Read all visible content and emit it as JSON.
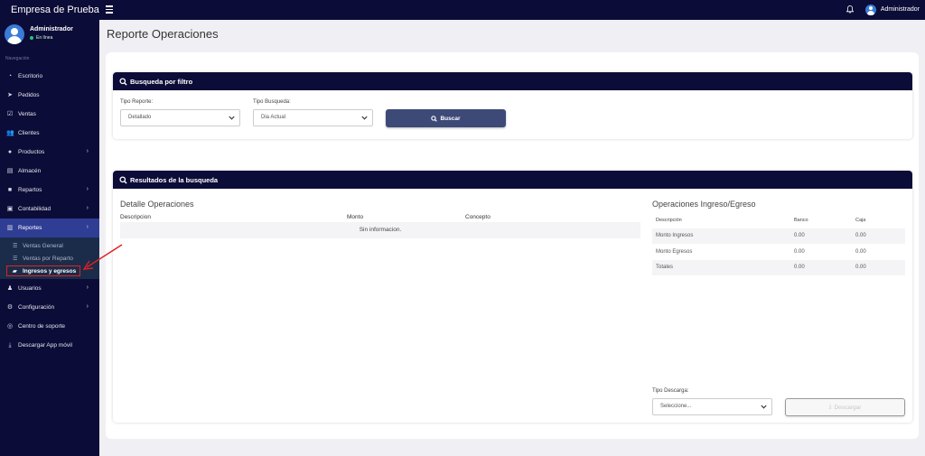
{
  "brand": "Empresa de Prueba",
  "user": {
    "name": "Administrador",
    "status": "En línea"
  },
  "nav": {
    "header": "Navegación",
    "items": [
      {
        "label": "Escritorio",
        "icon": "gauge-icon"
      },
      {
        "label": "Pedidos",
        "icon": "paper-plane-icon"
      },
      {
        "label": "Ventas",
        "icon": "check-square-icon"
      },
      {
        "label": "Clientes",
        "icon": "users-icon"
      },
      {
        "label": "Productos",
        "icon": "box-icon"
      },
      {
        "label": "Almacén",
        "icon": "file-icon"
      },
      {
        "label": "Repartos",
        "icon": "truck-icon"
      },
      {
        "label": "Contabilidad",
        "icon": "money-icon"
      },
      {
        "label": "Reportes",
        "icon": "chart-icon"
      },
      {
        "label": "Usuarios",
        "icon": "user-icon"
      },
      {
        "label": "Configuración",
        "icon": "gears-icon"
      },
      {
        "label": "Centro de soporte",
        "icon": "lifebuoy-icon"
      },
      {
        "label": "Descargar App móvil",
        "icon": "download-icon"
      }
    ],
    "reportes_sub": [
      {
        "label": "Ventas General"
      },
      {
        "label": "Ventas por Reparto"
      },
      {
        "label": "Ingresos y egresos"
      }
    ]
  },
  "topbar": {
    "user": "Administrador"
  },
  "page": {
    "title": "Reporte Operaciones"
  },
  "filter": {
    "header": "Busqueda por filtro",
    "tipo_reporte_label": "Tipo Reporte:",
    "tipo_reporte_value": "Detallado",
    "tipo_busqueda_label": "Tipo Busqueda:",
    "tipo_busqueda_value": "Dia Actual",
    "buscar_label": "Buscar"
  },
  "results": {
    "header": "Resultados de la busqueda",
    "detalle_title": "Detalle Operaciones",
    "columns": [
      "Descripcion",
      "Monto",
      "Concepto"
    ],
    "empty_text": "Sin informacion.",
    "io_title": "Operaciones Ingreso/Egreso",
    "io_columns": [
      "Descripción",
      "Banco",
      "Caja"
    ],
    "io_rows": [
      {
        "desc": "Monto Ingresos",
        "banco": "0.00",
        "caja": "0.00"
      },
      {
        "desc": "Monto Egresos",
        "banco": "0.00",
        "caja": "0.00"
      },
      {
        "desc": "Totales",
        "banco": "0.00",
        "caja": "0.00"
      }
    ],
    "tipo_descarga_label": "Tipo Descarga:",
    "tipo_descarga_value": "Seleccione...",
    "descargar_label": "Descargar"
  },
  "colors": {
    "navy": "#0c0c38",
    "active_nav": "#2f3e94",
    "button": "#3d4a78",
    "highlight": "#e02020"
  }
}
